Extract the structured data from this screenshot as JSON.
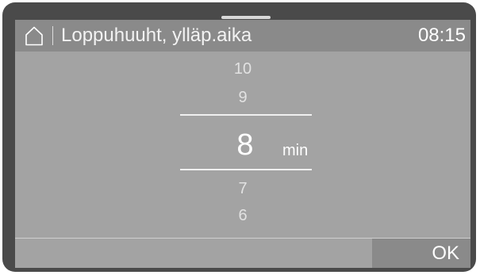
{
  "header": {
    "title": "Loppuhuuht, ylläp.aika",
    "time": "08:15",
    "home_icon": "home-icon"
  },
  "picker": {
    "values_above": [
      "10",
      "9"
    ],
    "selected": "8",
    "unit": "min",
    "values_below": [
      "7",
      "6"
    ]
  },
  "footer": {
    "ok_label": "OK"
  },
  "colors": {
    "bezel": "#4a4a4a",
    "screen_background": "#a3a3a3",
    "header_background": "#8a8a8a",
    "button_background": "#8a8a8a",
    "text": "#ffffff"
  }
}
